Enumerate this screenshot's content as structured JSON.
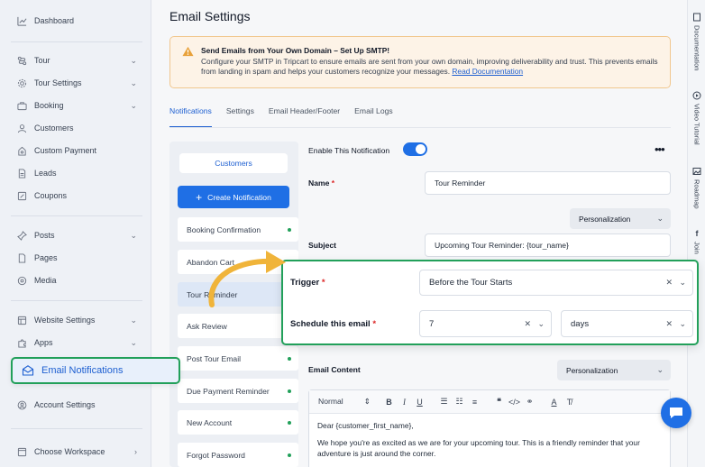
{
  "sidebar": {
    "items": [
      {
        "label": "Dashboard",
        "icon": "chart-icon"
      },
      {
        "label": "Tour",
        "icon": "route-icon"
      },
      {
        "label": "Tour Settings",
        "icon": "gear-icon"
      },
      {
        "label": "Booking",
        "icon": "briefcase-icon"
      },
      {
        "label": "Customers",
        "icon": "user-icon"
      },
      {
        "label": "Custom Payment",
        "icon": "payment-icon"
      },
      {
        "label": "Leads",
        "icon": "document-icon"
      },
      {
        "label": "Coupons",
        "icon": "coupon-icon"
      },
      {
        "label": "Posts",
        "icon": "pin-icon"
      },
      {
        "label": "Pages",
        "icon": "page-icon"
      },
      {
        "label": "Media",
        "icon": "media-icon"
      },
      {
        "label": "Website Settings",
        "icon": "grid-icon"
      },
      {
        "label": "Apps",
        "icon": "puzzle-icon"
      },
      {
        "label": "Email Notifications",
        "icon": "mail-icon"
      },
      {
        "label": "Account Settings",
        "icon": "account-icon"
      },
      {
        "label": "Choose Workspace",
        "icon": "workspace-icon"
      }
    ]
  },
  "page": {
    "title": "Email Settings"
  },
  "alert": {
    "title": "Send Emails from Your Own Domain – Set Up SMTP!",
    "body": "Configure your SMTP in Tripcart to ensure emails are sent from your own domain, improving deliverability and trust. This prevents emails from landing in spam and helps your customers recognize your messages.",
    "link": "Read Documentation"
  },
  "tabs": [
    "Notifications",
    "Settings",
    "Email Header/Footer",
    "Email Logs"
  ],
  "list": {
    "audience": "Customers",
    "create_label": "Create Notification",
    "items": [
      "Booking Confirmation",
      "Abandon Cart",
      "Tour Reminder",
      "Ask Review",
      "Post Tour Email",
      "Due Payment Reminder",
      "New Account",
      "Forgot Password"
    ]
  },
  "form": {
    "enable_label": "Enable This Notification",
    "name_label": "Name",
    "name_value": "Tour Reminder",
    "personalization_label": "Personalization",
    "subject_label": "Subject",
    "subject_value": "Upcoming Tour Reminder: {tour_name}",
    "trigger_label": "Trigger",
    "trigger_value": "Before the Tour Starts",
    "schedule_label": "Schedule this email",
    "schedule_value": "7",
    "schedule_unit": "days",
    "content_label": "Email Content",
    "required_mark": "*"
  },
  "editor": {
    "format": "Normal",
    "line1": "Dear {customer_first_name},",
    "line2": "We hope you're as excited as we are for your upcoming tour. This is a friendly reminder that your adventure is just around the corner."
  },
  "rail": [
    "Documentation",
    "Video Tutorial",
    "Roadmap",
    "Join"
  ],
  "colors": {
    "accent": "#1f6fe5",
    "highlight": "#22a05a",
    "warning": "#e8a13a"
  }
}
